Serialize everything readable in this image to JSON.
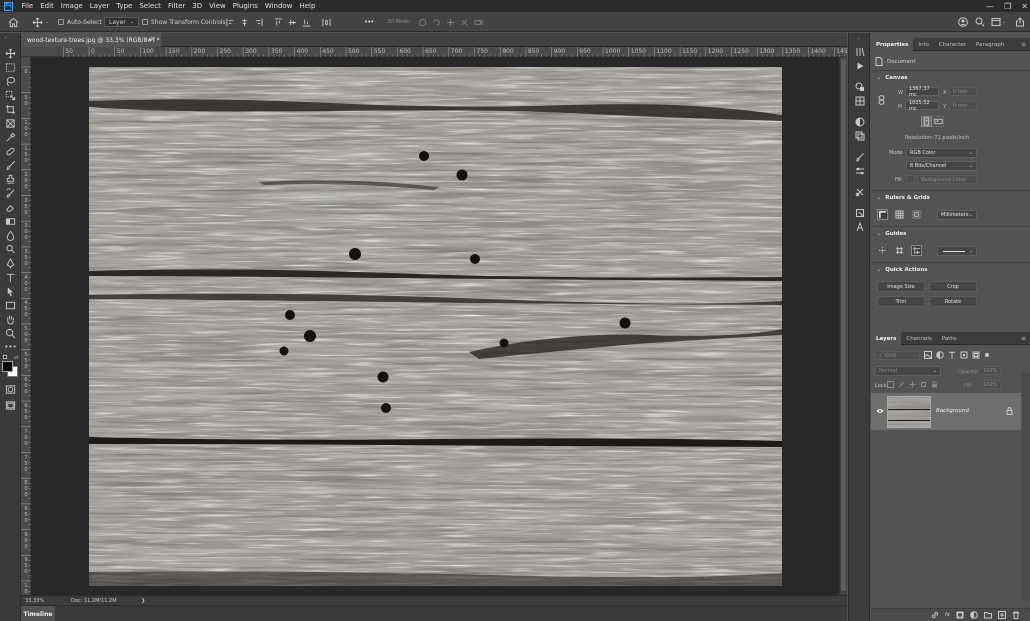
{
  "app": {
    "logo": "Ps"
  },
  "menu": [
    "File",
    "Edit",
    "Image",
    "Layer",
    "Type",
    "Select",
    "Filter",
    "3D",
    "View",
    "Plugins",
    "Window",
    "Help"
  ],
  "window_controls": {
    "minimize": "—",
    "maximize": "❐",
    "close": "✕"
  },
  "options": {
    "auto_select_label": "Auto-Select",
    "auto_select_target": "Layer",
    "show_transform_label": "Show Transform Controls",
    "mode_3d_label": "3D Mode:",
    "more": "•••"
  },
  "document": {
    "tab_title": "wood-texture-trees.jpg @ 33,3% (RGB/8#) *",
    "close": "×"
  },
  "ruler": {
    "top": [
      "0",
      "50",
      "100",
      "150",
      "200",
      "250",
      "300",
      "350",
      "400",
      "450",
      "500",
      "550",
      "600",
      "650",
      "700",
      "750",
      "800",
      "850",
      "900",
      "950",
      "1000",
      "1050",
      "1100",
      "1150",
      "1200",
      "1250",
      "1300",
      "1350",
      "1400",
      "1450"
    ],
    "top_first": "50"
  },
  "status": {
    "zoom": "33,33%",
    "doc": "Doc: 11,2M/11,2M",
    "arrow": "❯"
  },
  "timeline": {
    "tab": "Timeline"
  },
  "properties": {
    "tabs": [
      "Properties",
      "Info",
      "Character",
      "Paragraph"
    ],
    "doc_label": "Document",
    "canvas": {
      "title": "Canvas",
      "w_label": "W",
      "w_value": "1367,37 mc",
      "h_label": "H",
      "h_value": "1025,52 mc",
      "x_label": "X",
      "x_placeholder": "0 mm",
      "y_label": "Y",
      "y_placeholder": "0 mm",
      "resolution": "Resolution: 72 pixels/inch",
      "mode_label": "Mode",
      "mode_value": "RGB Color",
      "bits_value": "8 Bits/Channel",
      "fill_label": "Fill",
      "fill_value": "Background Color"
    },
    "rulers_grids": {
      "title": "Rulers & Grids",
      "unit": "Millimeters"
    },
    "guides": {
      "title": "Guides"
    },
    "quick_actions": {
      "title": "Quick Actions",
      "buttons": [
        "Image Size",
        "Crop",
        "Trim",
        "Rotate"
      ]
    }
  },
  "layers": {
    "tabs": [
      "Layers",
      "Channels",
      "Paths"
    ],
    "kind_placeholder": "Kind",
    "blend_mode": "Normal",
    "opacity_label": "Opacity:",
    "opacity_value": "100%",
    "lock_label": "Lock:",
    "fill_label": "Fill:",
    "fill_value": "100%",
    "items": [
      {
        "name": "Background",
        "visible": true,
        "locked": true
      }
    ],
    "footer_icons": [
      "link-icon",
      "fx-icon",
      "mask-icon",
      "adjustment-icon",
      "group-icon",
      "new-layer-icon",
      "trash-icon"
    ],
    "fx_label": "fx"
  },
  "colors": {
    "accent": "#31a8ff",
    "panel_bg": "#535353",
    "dark_bg": "#282828"
  }
}
